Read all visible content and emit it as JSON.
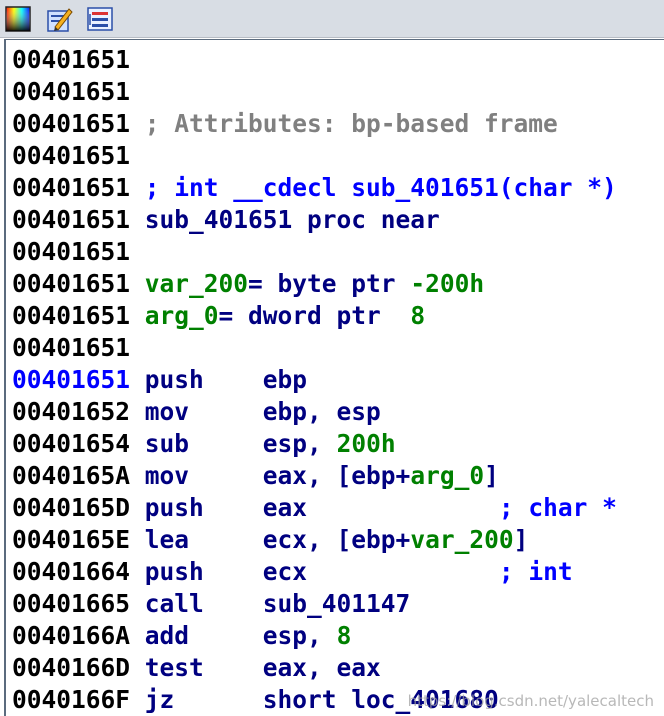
{
  "toolbar": {
    "icons": [
      "palette-icon",
      "edit-icon",
      "graph-view-icon"
    ]
  },
  "colors": {
    "address": "#000000",
    "current_address": "#0000ff",
    "mnemonic": "#000080",
    "comment": "#808080",
    "variable": "#008000"
  },
  "lines": [
    {
      "addr": "00401651",
      "parts": []
    },
    {
      "addr": "00401651",
      "parts": []
    },
    {
      "addr": "00401651",
      "parts": [
        {
          "t": "; Attributes: bp-based frame",
          "c": "cm"
        }
      ]
    },
    {
      "addr": "00401651",
      "parts": []
    },
    {
      "addr": "00401651",
      "parts": [
        {
          "t": "; int __cdecl sub_401651(char *)",
          "c": "cmb"
        }
      ]
    },
    {
      "addr": "00401651",
      "parts": [
        {
          "t": "sub_401651 proc near",
          "c": "kw"
        }
      ]
    },
    {
      "addr": "00401651",
      "parts": []
    },
    {
      "addr": "00401651",
      "parts": [
        {
          "t": "var_200",
          "c": "var"
        },
        {
          "t": "= byte ptr ",
          "c": "kw"
        },
        {
          "t": "-200h",
          "c": "num"
        }
      ]
    },
    {
      "addr": "00401651",
      "parts": [
        {
          "t": "arg_0",
          "c": "var"
        },
        {
          "t": "= dword ptr  ",
          "c": "kw"
        },
        {
          "t": "8",
          "c": "num"
        }
      ]
    },
    {
      "addr": "00401651",
      "parts": []
    },
    {
      "addr": "00401651",
      "current": true,
      "parts": [
        {
          "t": "push    ",
          "c": "mn"
        },
        {
          "t": "ebp",
          "c": "op"
        }
      ]
    },
    {
      "addr": "00401652",
      "parts": [
        {
          "t": "mov     ",
          "c": "mn"
        },
        {
          "t": "ebp, esp",
          "c": "op"
        }
      ]
    },
    {
      "addr": "00401654",
      "parts": [
        {
          "t": "sub     ",
          "c": "mn"
        },
        {
          "t": "esp, ",
          "c": "op"
        },
        {
          "t": "200h",
          "c": "num"
        }
      ]
    },
    {
      "addr": "0040165A",
      "parts": [
        {
          "t": "mov     ",
          "c": "mn"
        },
        {
          "t": "eax, [ebp+",
          "c": "op"
        },
        {
          "t": "arg_0",
          "c": "var"
        },
        {
          "t": "]",
          "c": "op"
        }
      ]
    },
    {
      "addr": "0040165D",
      "parts": [
        {
          "t": "push    ",
          "c": "mn"
        },
        {
          "t": "eax             ",
          "c": "op"
        },
        {
          "t": "; char *",
          "c": "cmb"
        }
      ]
    },
    {
      "addr": "0040165E",
      "parts": [
        {
          "t": "lea     ",
          "c": "mn"
        },
        {
          "t": "ecx, [ebp+",
          "c": "op"
        },
        {
          "t": "var_200",
          "c": "var"
        },
        {
          "t": "]",
          "c": "op"
        }
      ]
    },
    {
      "addr": "00401664",
      "parts": [
        {
          "t": "push    ",
          "c": "mn"
        },
        {
          "t": "ecx             ",
          "c": "op"
        },
        {
          "t": "; int",
          "c": "cmb"
        }
      ]
    },
    {
      "addr": "00401665",
      "parts": [
        {
          "t": "call    ",
          "c": "mn"
        },
        {
          "t": "sub_401147",
          "c": "op"
        }
      ]
    },
    {
      "addr": "0040166A",
      "parts": [
        {
          "t": "add     ",
          "c": "mn"
        },
        {
          "t": "esp, ",
          "c": "op"
        },
        {
          "t": "8",
          "c": "num"
        }
      ]
    },
    {
      "addr": "0040166D",
      "parts": [
        {
          "t": "test    ",
          "c": "mn"
        },
        {
          "t": "eax, eax",
          "c": "op"
        }
      ]
    },
    {
      "addr": "0040166F",
      "parts": [
        {
          "t": "jz      ",
          "c": "mn"
        },
        {
          "t": "short loc_401680",
          "c": "op"
        }
      ]
    }
  ],
  "watermark": "https://blog.csdn.net/yalecaltech"
}
